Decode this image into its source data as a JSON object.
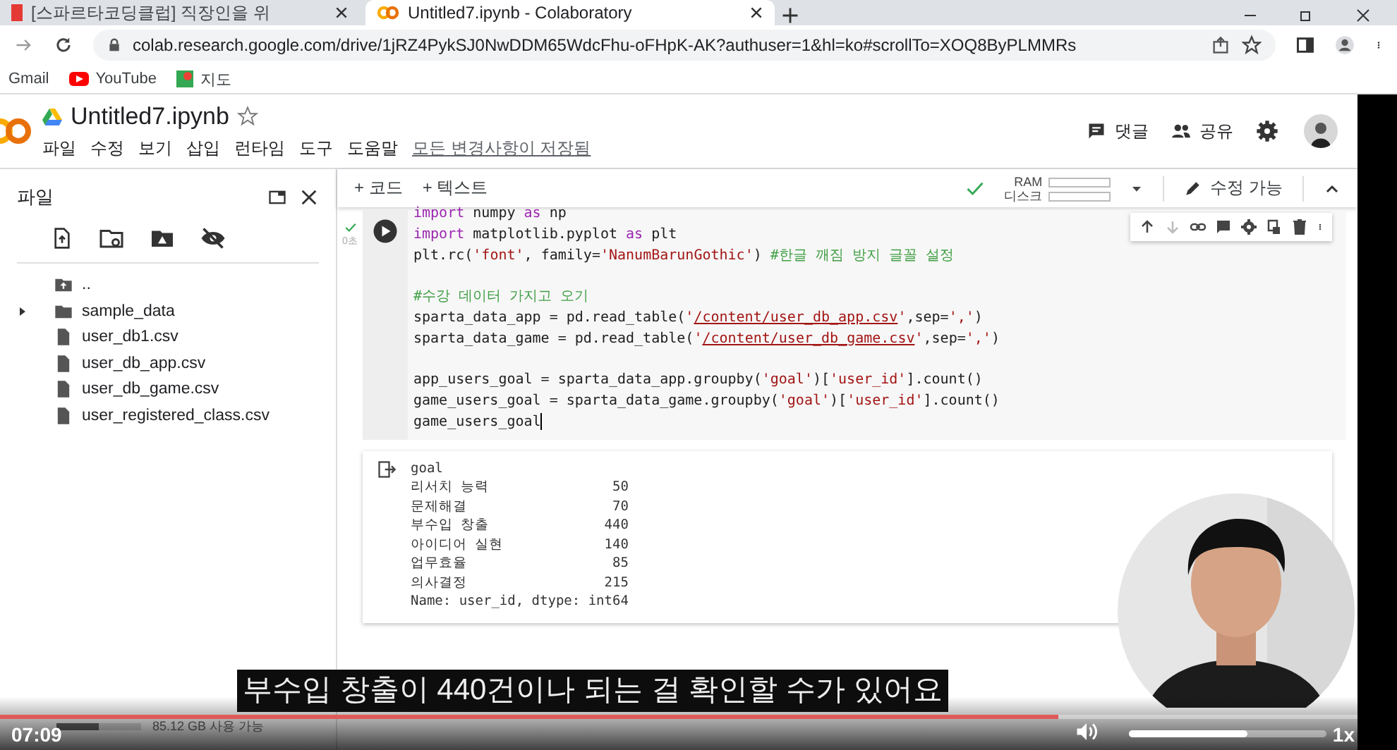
{
  "browser": {
    "tabs": [
      {
        "title": "[스파르타코딩클럽] 직장인을 위",
        "selected": false
      },
      {
        "title": "Untitled7.ipynb - Colaboratory",
        "selected": true
      }
    ],
    "url": "colab.research.google.com/drive/1jRZ4PykSJ0NwDDM65WdcFhu-oFHpK-AK?authuser=1&hl=ko#scrollTo=XOQ8ByPLMMRs",
    "bookmarks": [
      "Gmail",
      "YouTube",
      "지도"
    ]
  },
  "notebook": {
    "title": "Untitled7.ipynb",
    "menu": [
      "파일",
      "수정",
      "보기",
      "삽입",
      "런타임",
      "도구",
      "도움말"
    ],
    "save_status": "모든 변경사항이 저장됨",
    "actions": [
      {
        "kind": "comment",
        "label": "댓글"
      },
      {
        "kind": "share",
        "label": "공유"
      }
    ],
    "add_buttons": [
      "+ 코드",
      "+ 텍스트"
    ],
    "ram_label": "RAM",
    "disk_label": "디스크",
    "edit_label": "수정 가능"
  },
  "sidebar": {
    "title": "파일",
    "files": [
      {
        "kind": "parent",
        "name": ".."
      },
      {
        "kind": "folder",
        "name": "sample_data"
      },
      {
        "kind": "file",
        "name": "user_db1.csv"
      },
      {
        "kind": "file",
        "name": "user_db_app.csv"
      },
      {
        "kind": "file",
        "name": "user_db_game.csv"
      },
      {
        "kind": "file",
        "name": "user_registered_class.csv"
      }
    ],
    "storage": "85.12 GB 사용 가능"
  },
  "cell": {
    "duration": "0초",
    "code_blocks": [
      [
        [
          {
            "t": "import",
            "color": "#9c27b0"
          },
          {
            "t": " numpy "
          },
          {
            "t": "as",
            "color": "#9c27b0"
          },
          {
            "t": " np"
          }
        ],
        [
          {
            "t": "import",
            "color": "#9c27b0"
          },
          {
            "t": " matplotlib.pyplot "
          },
          {
            "t": "as",
            "color": "#9c27b0"
          },
          {
            "t": " plt"
          }
        ],
        [
          {
            "t": "plt.rc("
          },
          {
            "t": "'font'",
            "color": "#a31515"
          },
          {
            "t": ", family="
          },
          {
            "t": "'NanumBarunGothic'",
            "color": "#a31515"
          },
          {
            "t": ") "
          },
          {
            "t": "#한글 깨짐 방지 글꼴 설정",
            "color": "#43a047"
          }
        ]
      ],
      [
        [
          {
            "t": "#수강 데이터 가지고 오기",
            "color": "#43a047"
          }
        ],
        [
          {
            "t": "sparta_data_app = pd.read_table("
          },
          {
            "t": "'",
            "color": "#a31515"
          },
          {
            "t": "/content/user_db_app.csv",
            "color": "#a31515",
            "link": true
          },
          {
            "t": "'",
            "color": "#a31515"
          },
          {
            "t": ",sep="
          },
          {
            "t": "','",
            "color": "#a31515"
          },
          {
            "t": ")"
          }
        ],
        [
          {
            "t": "sparta_data_game = pd.read_table("
          },
          {
            "t": "'",
            "color": "#a31515"
          },
          {
            "t": "/content/user_db_game.csv",
            "color": "#a31515",
            "link": true
          },
          {
            "t": "'",
            "color": "#a31515"
          },
          {
            "t": ",sep="
          },
          {
            "t": "','",
            "color": "#a31515"
          },
          {
            "t": ")"
          }
        ]
      ],
      [
        [
          {
            "t": "app_users_goal = sparta_data_app.groupby("
          },
          {
            "t": "'goal'",
            "color": "#a31515"
          },
          {
            "t": ")["
          },
          {
            "t": "'user_id'",
            "color": "#a31515"
          },
          {
            "t": "].count()"
          }
        ],
        [
          {
            "t": "game_users_goal = sparta_data_game.groupby("
          },
          {
            "t": "'goal'",
            "color": "#a31515"
          },
          {
            "t": ")["
          },
          {
            "t": "'user_id'",
            "color": "#a31515"
          },
          {
            "t": "].count()"
          }
        ],
        [
          {
            "t": "game_users_goal"
          }
        ]
      ]
    ],
    "output": {
      "header": "goal",
      "rows": [
        {
          "index": "리서치 능력",
          "value": "50"
        },
        {
          "index": "문제해결",
          "value": "70"
        },
        {
          "index": "부수입 창출",
          "value": "440"
        },
        {
          "index": "아이디어 실현",
          "value": "140"
        },
        {
          "index": "업무효율",
          "value": "85"
        },
        {
          "index": "의사결정",
          "value": "215"
        }
      ],
      "footer": "Name: user_id, dtype: int64"
    }
  },
  "video": {
    "subtitle": "부수입 창출이 440건이나 되는 걸 확인할 수가 있어요",
    "time": "07:09",
    "progress": {
      "level": 0.78
    },
    "volume": {
      "level": 0.6
    },
    "speed": "1x"
  }
}
